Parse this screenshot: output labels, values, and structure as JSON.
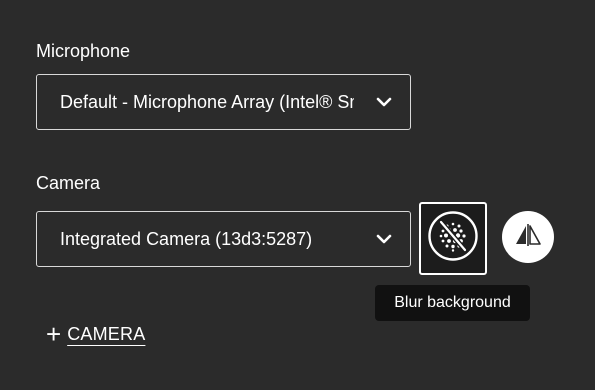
{
  "microphone": {
    "label": "Microphone",
    "selected": "Default - Microphone Array (Intel® Smart Sound Technology for Digital Microphones)"
  },
  "camera": {
    "label": "Camera",
    "selected": "Integrated Camera (13d3:5287)"
  },
  "blur_button": {
    "icon": "blur-background-icon",
    "tooltip": "Blur background"
  },
  "mirror_button": {
    "icon": "mirror-video-icon"
  },
  "add_camera": {
    "plus": "+",
    "label": "CAMERA"
  },
  "colors": {
    "background": "#2b2b2b",
    "border": "#d9d9d9",
    "tooltip_bg": "#111111",
    "text": "#ffffff"
  }
}
